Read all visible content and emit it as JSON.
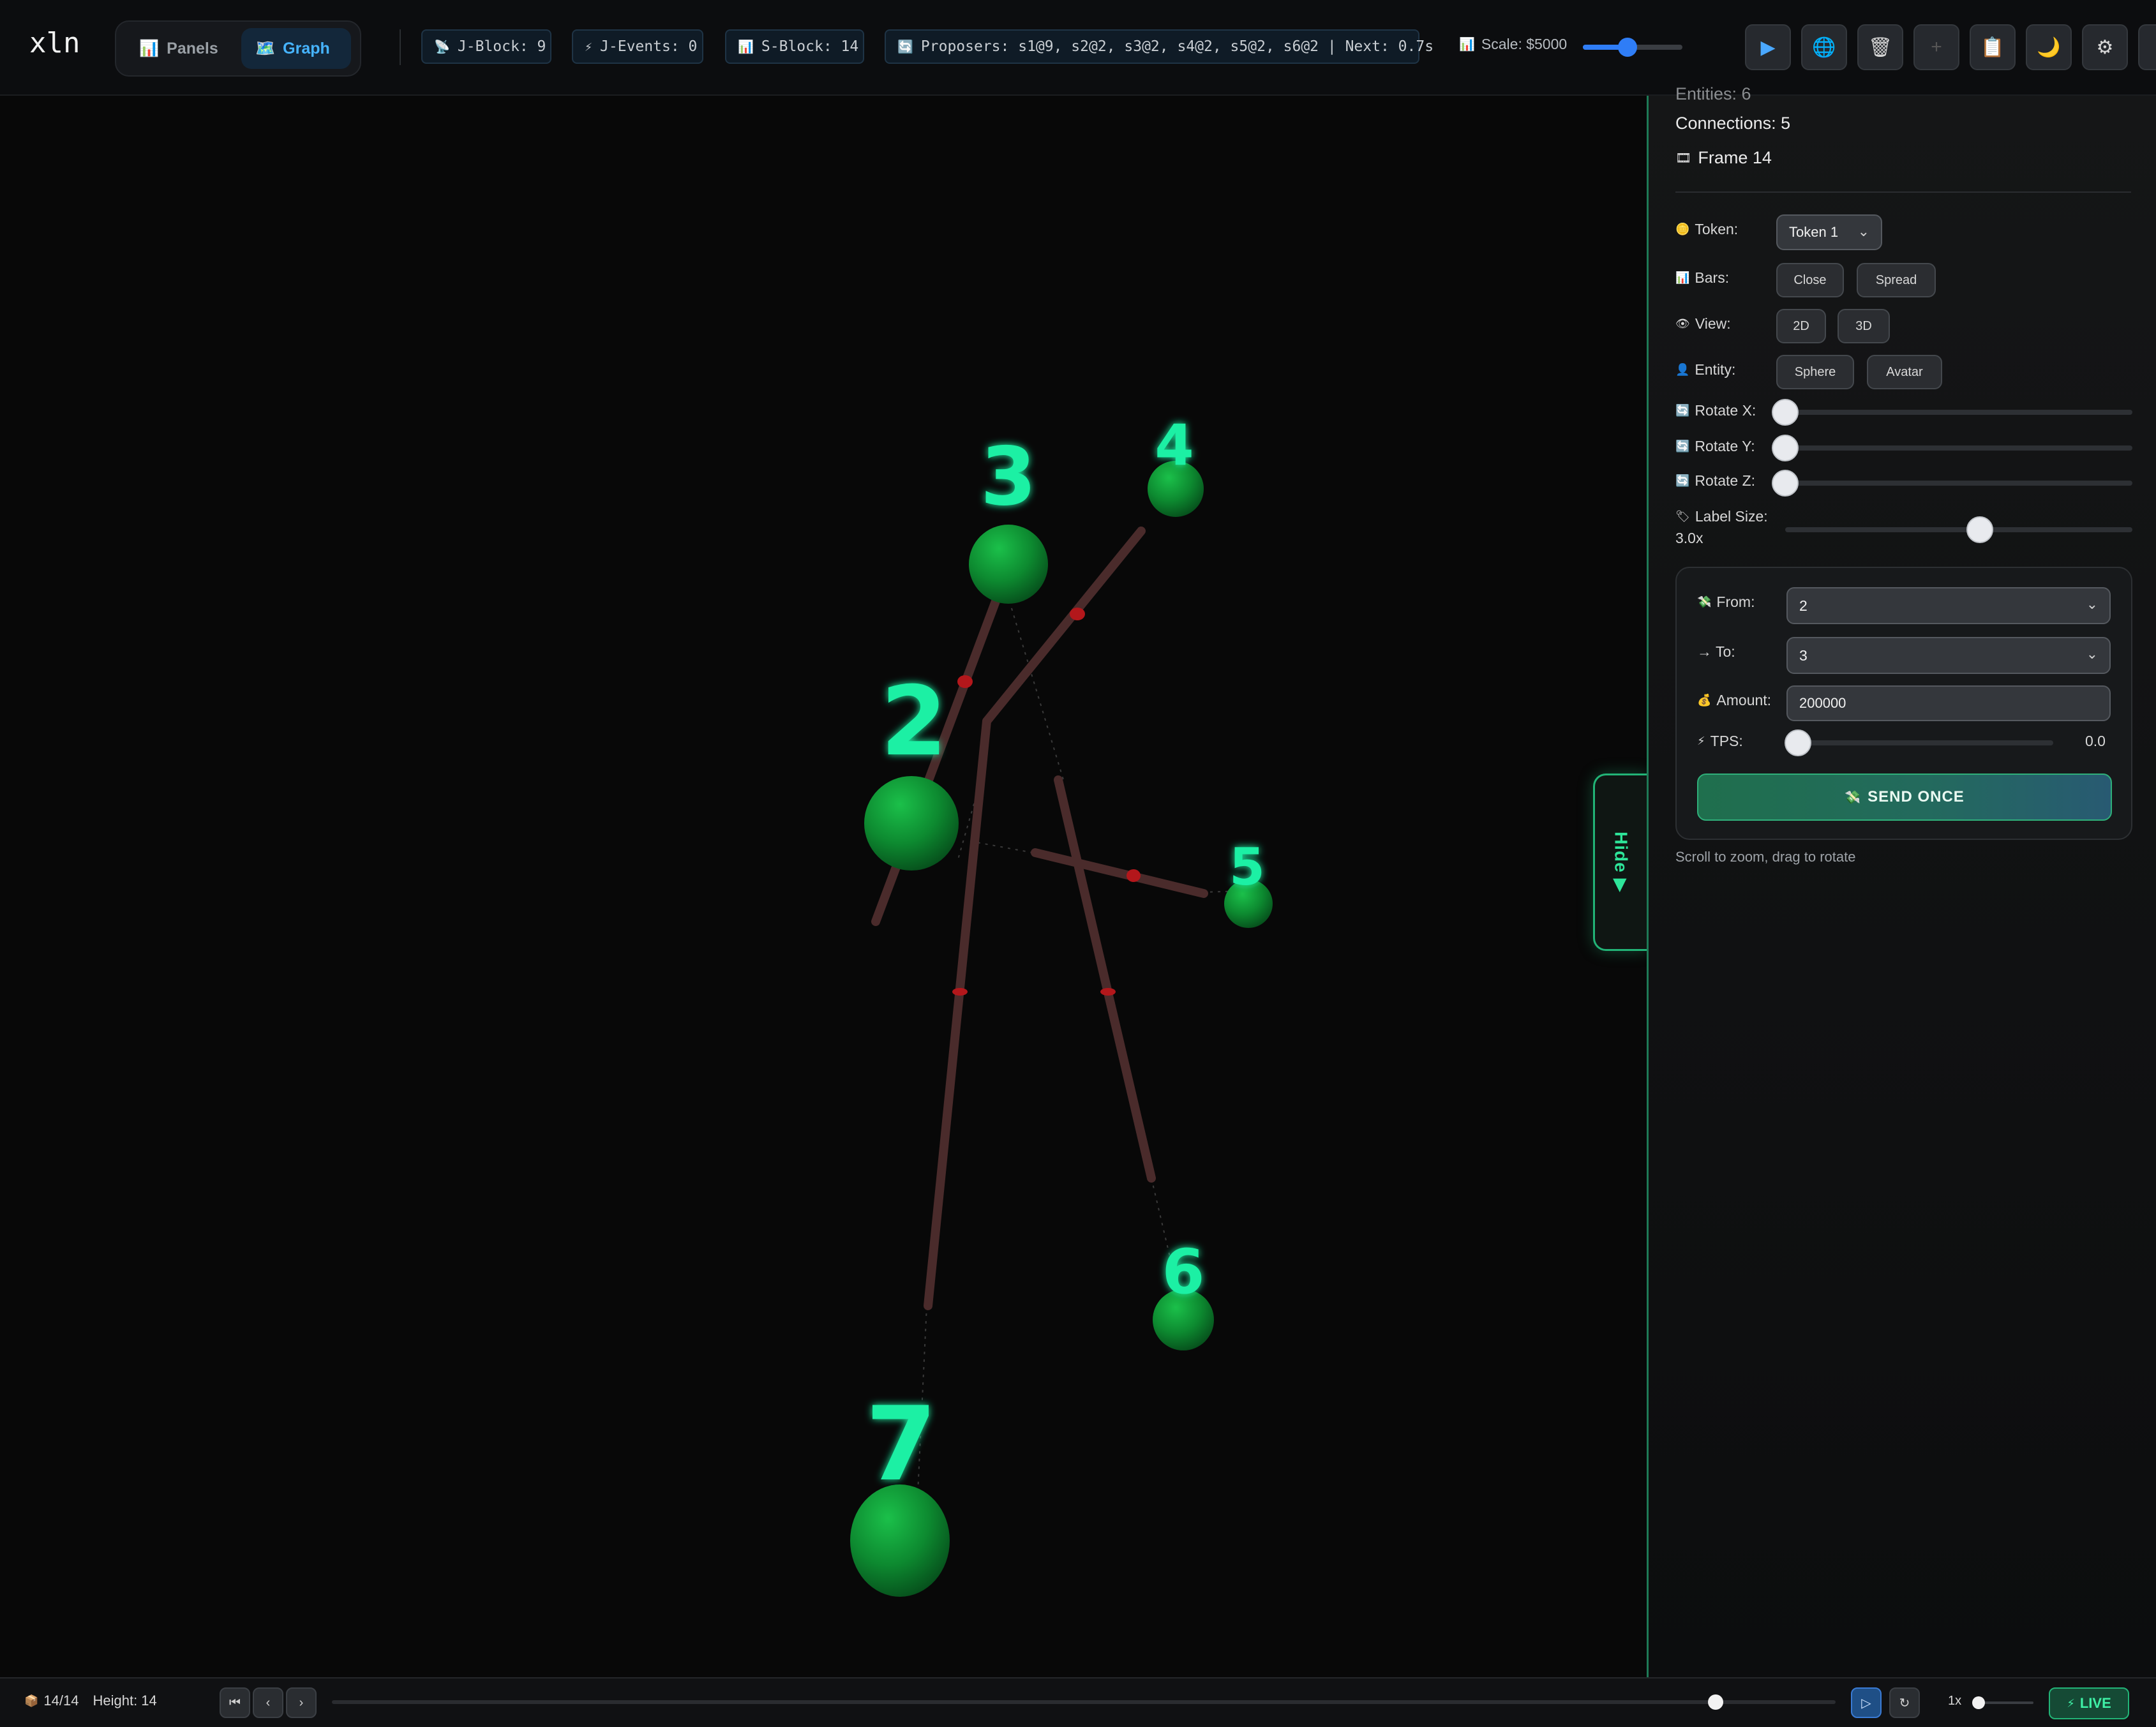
{
  "header": {
    "logo": "xln",
    "view_tabs": [
      {
        "label": "Panels",
        "icon": "bar-chart-icon"
      },
      {
        "label": "Graph",
        "icon": "map-icon"
      }
    ],
    "status_chips": {
      "j_block": "J-Block: 9",
      "j_events": "J-Events: 0",
      "s_block": "S-Block: 14",
      "proposers": "Proposers: s1@9, s2@2, s3@2, s4@2, s5@2, s6@2 | Next: 0.7s"
    },
    "scale_label": "Scale: $5000",
    "scale_fraction": 0.45,
    "toolbar_icons": [
      "play-icon",
      "globe-icon",
      "trash-icon",
      "plus-icon",
      "clipboard-icon",
      "moon-icon",
      "gear-icon"
    ]
  },
  "graph": {
    "nodes": [
      {
        "label": "2"
      },
      {
        "label": "3"
      },
      {
        "label": "4"
      },
      {
        "label": "5"
      },
      {
        "label": "6"
      },
      {
        "label": "7"
      }
    ],
    "node_color": "#0e8a33",
    "label_color": "#1cf0a4",
    "edge_color": "#4a2b2b",
    "edge_marker_color": "#b3171b",
    "hide_tab_label": "Hide ▶"
  },
  "sidebar": {
    "entities_label": "Entities: 6",
    "connections_label": "Connections: 5",
    "frame_label": "Frame 14",
    "token": {
      "label": "Token:",
      "value": "Token 1"
    },
    "bars": {
      "label": "Bars:",
      "options": [
        "Close",
        "Spread"
      ]
    },
    "view": {
      "label": "View:",
      "options": [
        "2D",
        "3D"
      ]
    },
    "entity": {
      "label": "Entity:",
      "options": [
        "Sphere",
        "Avatar"
      ]
    },
    "rotate_x": {
      "label": "Rotate X:",
      "value": 0
    },
    "rotate_y": {
      "label": "Rotate Y:",
      "value": 0
    },
    "rotate_z": {
      "label": "Rotate Z:",
      "value": 0
    },
    "label_size": {
      "label": "Label Size:",
      "value_text": "3.0x",
      "fraction": 0.56
    },
    "payment": {
      "from_label": "From:",
      "from_value": "2",
      "to_label": "→ To:",
      "to_value": "3",
      "amount_label": "Amount:",
      "amount_value": "200000",
      "tps_label": "TPS:",
      "tps_value": "0.0",
      "send_label": "SEND ONCE"
    },
    "hint": "Scroll to zoom, drag to rotate"
  },
  "footer": {
    "frame_counter": "14/14",
    "height_label": "Height: 14",
    "timeline_fraction": 0.92,
    "speed_label": "1x",
    "live_label": "LIVE"
  }
}
